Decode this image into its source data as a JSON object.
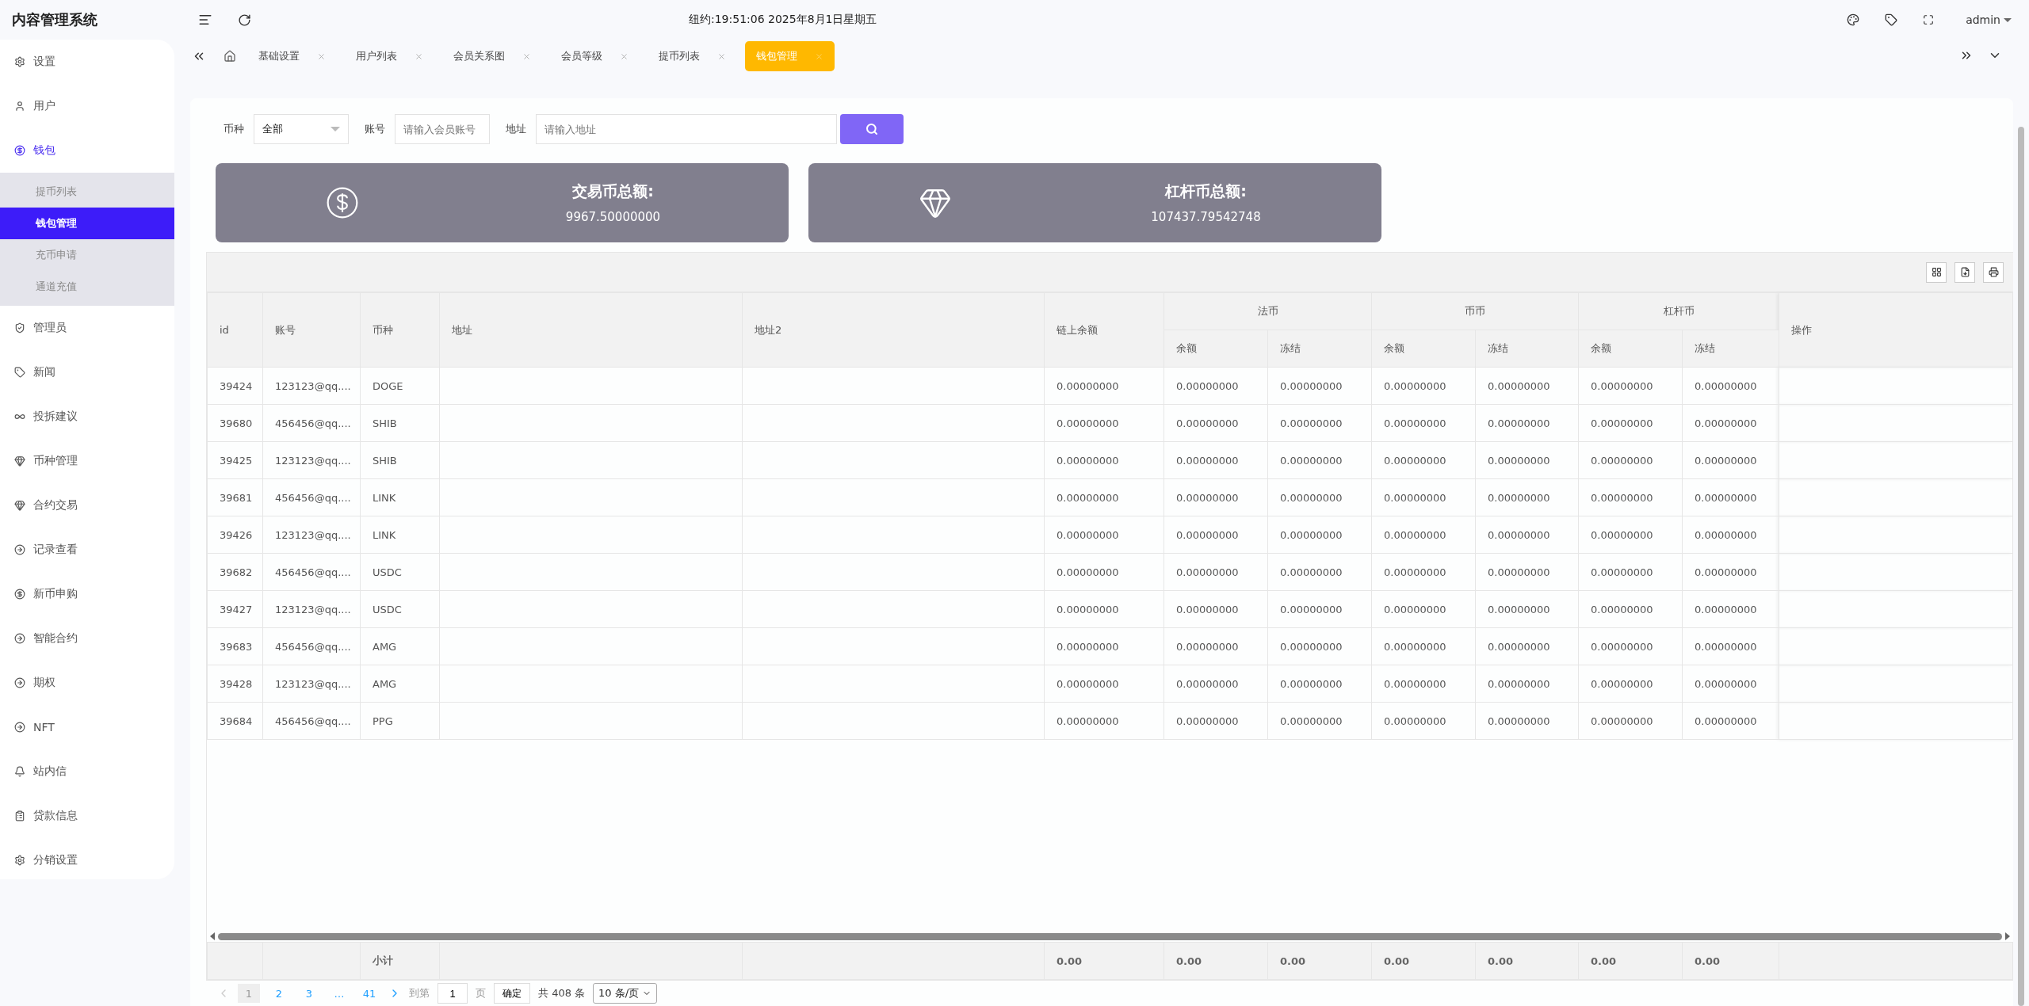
{
  "app": {
    "title": "内容管理系统"
  },
  "header": {
    "clock": "纽约:19:51:06 2025年8月1日星期五",
    "user": "admin"
  },
  "sidebar": {
    "items": [
      {
        "label": "设置",
        "selected": false
      },
      {
        "label": "用户",
        "selected": false
      },
      {
        "label": "钱包",
        "selected": true,
        "children": [
          {
            "label": "提币列表",
            "selected": false
          },
          {
            "label": "钱包管理",
            "selected": true
          },
          {
            "label": "充币申请",
            "selected": false
          },
          {
            "label": "通道充值",
            "selected": false
          }
        ]
      },
      {
        "label": "管理员",
        "selected": false
      },
      {
        "label": "新闻",
        "selected": false
      },
      {
        "label": "投拆建议",
        "selected": false
      },
      {
        "label": "币种管理",
        "selected": false
      },
      {
        "label": "合约交易",
        "selected": false
      },
      {
        "label": "记录查看",
        "selected": false
      },
      {
        "label": "新币申购",
        "selected": false
      },
      {
        "label": "智能合约",
        "selected": false
      },
      {
        "label": "期权",
        "selected": false
      },
      {
        "label": "NFT",
        "selected": false
      },
      {
        "label": "站内信",
        "selected": false
      },
      {
        "label": "贷款信息",
        "selected": false
      },
      {
        "label": "分销设置",
        "selected": false
      }
    ]
  },
  "tabs": [
    {
      "label": "基础设置",
      "selected": false
    },
    {
      "label": "用户列表",
      "selected": false
    },
    {
      "label": "会员关系图",
      "selected": false
    },
    {
      "label": "会员等级",
      "selected": false
    },
    {
      "label": "提币列表",
      "selected": false
    },
    {
      "label": "钱包管理",
      "selected": true
    }
  ],
  "filters": [
    {
      "kind": "select",
      "label": "币种",
      "value": "全部"
    },
    {
      "kind": "input",
      "label": "账号",
      "placeholder": "请输入会员账号"
    },
    {
      "kind": "input",
      "label": "地址",
      "placeholder": "请输入地址"
    }
  ],
  "summary_cards": [
    {
      "title": "交易币总额:",
      "value": "9967.50000000"
    },
    {
      "title": "杠杆币总额:",
      "value": "107437.79542748"
    }
  ],
  "table": {
    "columns": [
      {
        "label": "id"
      },
      {
        "label": "账号"
      },
      {
        "label": "币种"
      },
      {
        "label": "地址"
      },
      {
        "label": "地址2"
      },
      {
        "label": "链上余额"
      },
      {
        "label": "法币",
        "children": [
          "余额",
          "冻结"
        ]
      },
      {
        "label": "币币",
        "children": [
          "余额",
          "冻结"
        ]
      },
      {
        "label": "杠杆币",
        "children": [
          "余额",
          "冻结"
        ]
      },
      {
        "label": "操作"
      }
    ],
    "rows": [
      {
        "id": "39424",
        "account": "123123@qq....",
        "coin": "DOGE",
        "values": [
          "0.00000000",
          "0.00000000",
          "0.00000000",
          "0.00000000",
          "0.00000000",
          "0.00000000",
          "0.00000000"
        ]
      },
      {
        "id": "39680",
        "account": "456456@qq....",
        "coin": "SHIB",
        "values": [
          "0.00000000",
          "0.00000000",
          "0.00000000",
          "0.00000000",
          "0.00000000",
          "0.00000000",
          "0.00000000"
        ]
      },
      {
        "id": "39425",
        "account": "123123@qq....",
        "coin": "SHIB",
        "values": [
          "0.00000000",
          "0.00000000",
          "0.00000000",
          "0.00000000",
          "0.00000000",
          "0.00000000",
          "0.00000000"
        ]
      },
      {
        "id": "39681",
        "account": "456456@qq....",
        "coin": "LINK",
        "values": [
          "0.00000000",
          "0.00000000",
          "0.00000000",
          "0.00000000",
          "0.00000000",
          "0.00000000",
          "0.00000000"
        ]
      },
      {
        "id": "39426",
        "account": "123123@qq....",
        "coin": "LINK",
        "values": [
          "0.00000000",
          "0.00000000",
          "0.00000000",
          "0.00000000",
          "0.00000000",
          "0.00000000",
          "0.00000000"
        ]
      },
      {
        "id": "39682",
        "account": "456456@qq....",
        "coin": "USDC",
        "values": [
          "0.00000000",
          "0.00000000",
          "0.00000000",
          "0.00000000",
          "0.00000000",
          "0.00000000",
          "0.00000000"
        ]
      },
      {
        "id": "39427",
        "account": "123123@qq....",
        "coin": "USDC",
        "values": [
          "0.00000000",
          "0.00000000",
          "0.00000000",
          "0.00000000",
          "0.00000000",
          "0.00000000",
          "0.00000000"
        ]
      },
      {
        "id": "39683",
        "account": "456456@qq....",
        "coin": "AMG",
        "values": [
          "0.00000000",
          "0.00000000",
          "0.00000000",
          "0.00000000",
          "0.00000000",
          "0.00000000",
          "0.00000000"
        ]
      },
      {
        "id": "39428",
        "account": "123123@qq....",
        "coin": "AMG",
        "values": [
          "0.00000000",
          "0.00000000",
          "0.00000000",
          "0.00000000",
          "0.00000000",
          "0.00000000",
          "0.00000000"
        ]
      },
      {
        "id": "39684",
        "account": "456456@qq....",
        "coin": "PPG",
        "values": [
          "0.00000000",
          "0.00000000",
          "0.00000000",
          "0.00000000",
          "0.00000000",
          "0.00000000",
          "0.00000000"
        ]
      }
    ],
    "subtotal": {
      "label": "小计",
      "values": [
        "0.00",
        "0.00",
        "0.00",
        "0.00",
        "0.00",
        "0.00",
        "0.00"
      ]
    }
  },
  "pagination": {
    "pages": [
      {
        "label": "1",
        "selected": true
      },
      {
        "label": "2",
        "selected": false
      },
      {
        "label": "3",
        "selected": false
      },
      {
        "label": "…",
        "selected": false
      },
      {
        "label": "41",
        "selected": false
      }
    ],
    "goto_label": "到第",
    "goto_value": "1",
    "page_unit": "页",
    "confirm": "确定",
    "total": "共 408 条",
    "page_size": "10 条/页"
  }
}
